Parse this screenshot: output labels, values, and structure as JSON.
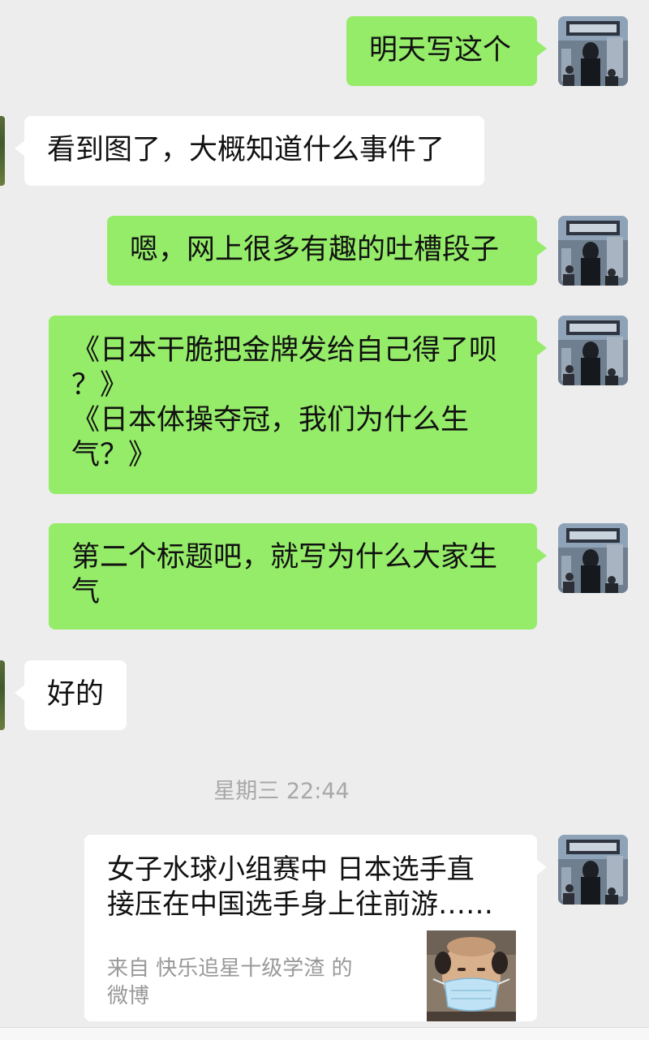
{
  "chat": {
    "messages": [
      {
        "sender": "me",
        "lines": [
          "明天写这个"
        ]
      },
      {
        "sender": "other",
        "lines": [
          "看到图了，大概知道什么事件了"
        ]
      },
      {
        "sender": "me",
        "lines": [
          "嗯，网上很多有趣的吐槽段子"
        ]
      },
      {
        "sender": "me",
        "lines": [
          "《日本干脆把金牌发给自己得了呗",
          "？》",
          "《日本体操夺冠，我们为什么生",
          "气？》"
        ]
      },
      {
        "sender": "me",
        "lines": [
          "第二个标题吧，就写为什么大家生",
          "气"
        ]
      },
      {
        "sender": "other",
        "lines": [
          "好的"
        ]
      }
    ],
    "timestamp": "星期三 22:44",
    "link_card": {
      "title_lines": [
        "女子水球小组赛中 日本选手直",
        "接压在中国选手身上往前游……"
      ],
      "source_lines": [
        "来自 快乐追星十级学渣 的",
        "微博"
      ]
    }
  },
  "colors": {
    "background": "#ededed",
    "my_bubble": "#95ec69",
    "other_bubble": "#ffffff",
    "timestamp": "#a8a8a8",
    "source_text": "#999999"
  },
  "icons": {
    "my_avatar": "photo-avatar",
    "other_avatar": "photo-avatar",
    "card_thumbnail": "masked-face-thumbnail"
  }
}
